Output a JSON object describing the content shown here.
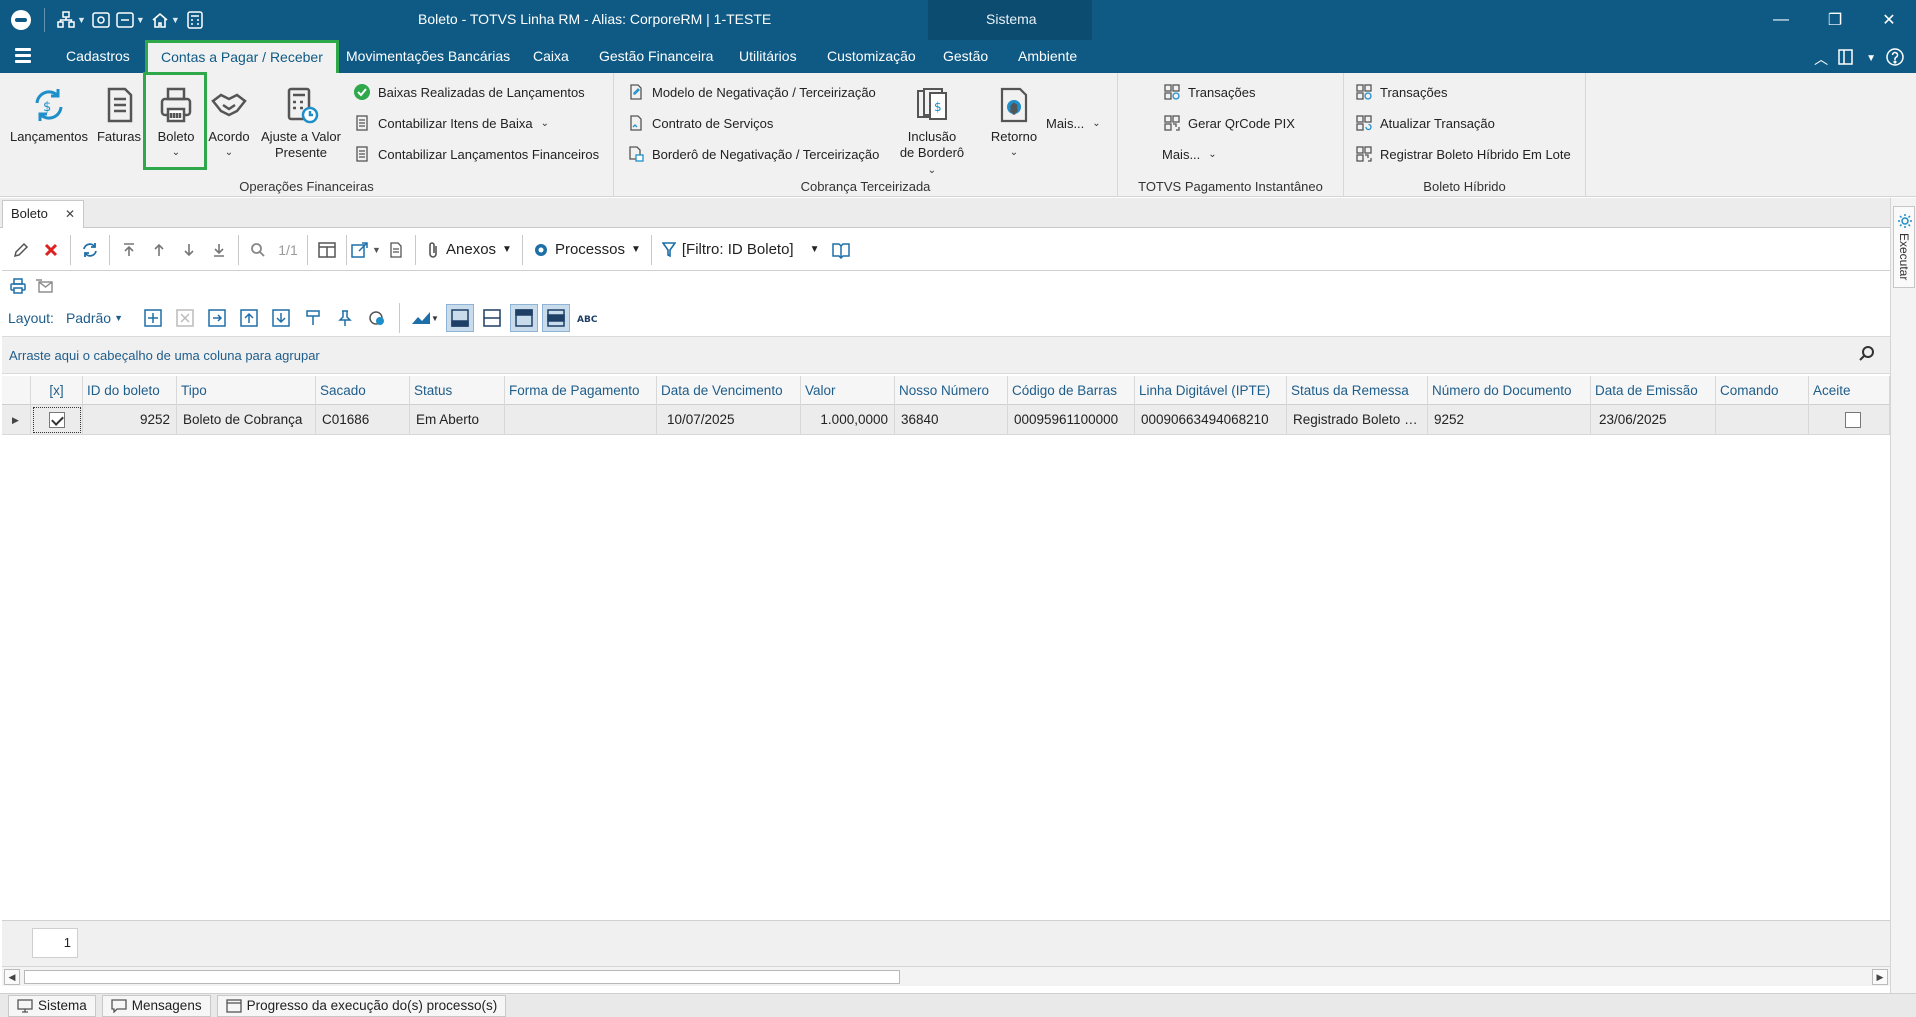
{
  "window": {
    "title": "Boleto - TOTVS Linha RM - Alias: CorporeRM | 1-TESTE",
    "sistema_tab": "Sistema",
    "minimize": "—",
    "restore": "❐",
    "close": "✕"
  },
  "menu": {
    "items": [
      "Cadastros",
      "Contas a Pagar / Receber",
      "Movimentações Bancárias",
      "Caixa",
      "Gestão Financeira",
      "Utilitários",
      "Customização",
      "Gestão",
      "Ambiente"
    ],
    "active_index": 1
  },
  "ribbon": {
    "operacoes": {
      "label": "Operações Financeiras",
      "lancamentos": "Lançamentos",
      "faturas": "Faturas",
      "boleto": "Boleto",
      "acordo": "Acordo",
      "ajuste_line1": "Ajuste a Valor",
      "ajuste_line2": "Presente",
      "baixas": "Baixas Realizadas de Lançamentos",
      "contabilizar_itens": "Contabilizar Itens de Baixa",
      "contabilizar_lanc": "Contabilizar Lançamentos Financeiros"
    },
    "cobranca": {
      "label": "Cobrança Terceirizada",
      "modelo": "Modelo de Negativação / Terceirização",
      "contrato": "Contrato de Serviços",
      "bordero": "Borderô de Negativação / Terceirização",
      "inclusao_line1": "Inclusão",
      "inclusao_line2": "de Borderô",
      "retorno": "Retorno",
      "mais": "Mais..."
    },
    "pix": {
      "label": "TOTVS Pagamento Instantâneo",
      "transacoes": "Transações",
      "gerar_qrcode": "Gerar QrCode PIX",
      "mais": "Mais..."
    },
    "hibrido": {
      "label": "Boleto Híbrido",
      "transacoes": "Transações",
      "atualizar": "Atualizar Transação",
      "registrar": "Registrar Boleto Híbrido Em Lote"
    }
  },
  "doc_tab": {
    "label": "Boleto"
  },
  "exec_panel": {
    "label": "Executar"
  },
  "toolbar": {
    "nav_count": "1/1",
    "anexos": "Anexos",
    "processos": "Processos",
    "filtro": "[Filtro: ID Boleto]"
  },
  "layout_bar": {
    "label": "Layout:",
    "value": "Padrão"
  },
  "group_hint": "Arraste aqui o cabeçalho de uma coluna para agrupar",
  "grid": {
    "columns": [
      "[x]",
      "ID do boleto",
      "Tipo",
      "Sacado",
      "Status",
      "Forma de Pagamento",
      "Data de Vencimento",
      "Valor",
      "Nosso Número",
      "Código de Barras",
      "Linha Digitável (IPTE)",
      "Status da Remessa",
      "Número do Documento",
      "Data de Emissão",
      "Comando",
      "Aceite"
    ],
    "rows": [
      {
        "id": "9252",
        "tipo": "Boleto de Cobrança",
        "sacado": "C01686",
        "status": "Em Aberto",
        "forma": "",
        "vencimento": "10/07/2025",
        "valor": "1.000,0000",
        "nosso_numero": "36840",
        "codigo_barras": "00095961100000",
        "linha_digitavel": "00090663494068210",
        "status_remessa": "Registrado Boleto Híbrido",
        "numero_doc": "9252",
        "emissao": "23/06/2025",
        "comando": ""
      }
    ]
  },
  "pager": {
    "page": "1"
  },
  "statusbar": {
    "sistema": "Sistema",
    "mensagens": "Mensagens",
    "progresso": "Progresso da execução do(s) processo(s)"
  },
  "colors": {
    "titlebar": "#0f5a85",
    "highlight": "#2ea84a",
    "link": "#1f5d8a"
  }
}
